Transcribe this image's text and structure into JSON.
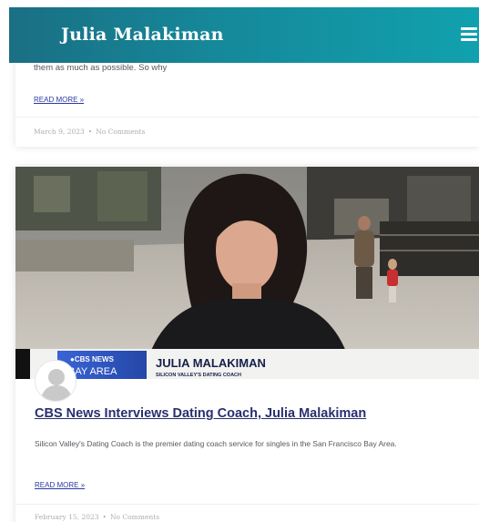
{
  "header": {
    "site_title": "Julia Malakiman",
    "menu_icon": "hamburger-icon"
  },
  "posts": [
    {
      "excerpt": "them as much as possible. So why",
      "read_more": "READ MORE »",
      "date": "March 9, 2023",
      "separator": "•",
      "comments": "No Comments"
    },
    {
      "title": "CBS News Interviews Dating Coach, Julia Malakiman",
      "excerpt": "Silicon Valley's Dating Coach is the premier dating coach service for singles in the San Francisco Bay Area.",
      "read_more": "READ MORE »",
      "date": "February 15, 2023",
      "separator": "•",
      "comments": "No Comments",
      "thumbnail": {
        "chyron_logo": "●CBS NEWS",
        "chyron_region": "BAY AREA",
        "chyron_name": "JULIA MALAKIMAN",
        "chyron_subtitle": "SILICON VALLEY'S DATING COACH"
      }
    }
  ],
  "colors": {
    "header_start": "#1a6f83",
    "header_end": "#11a1ae",
    "title_link": "#2a2f6e",
    "read_more": "#2b3aa3"
  }
}
